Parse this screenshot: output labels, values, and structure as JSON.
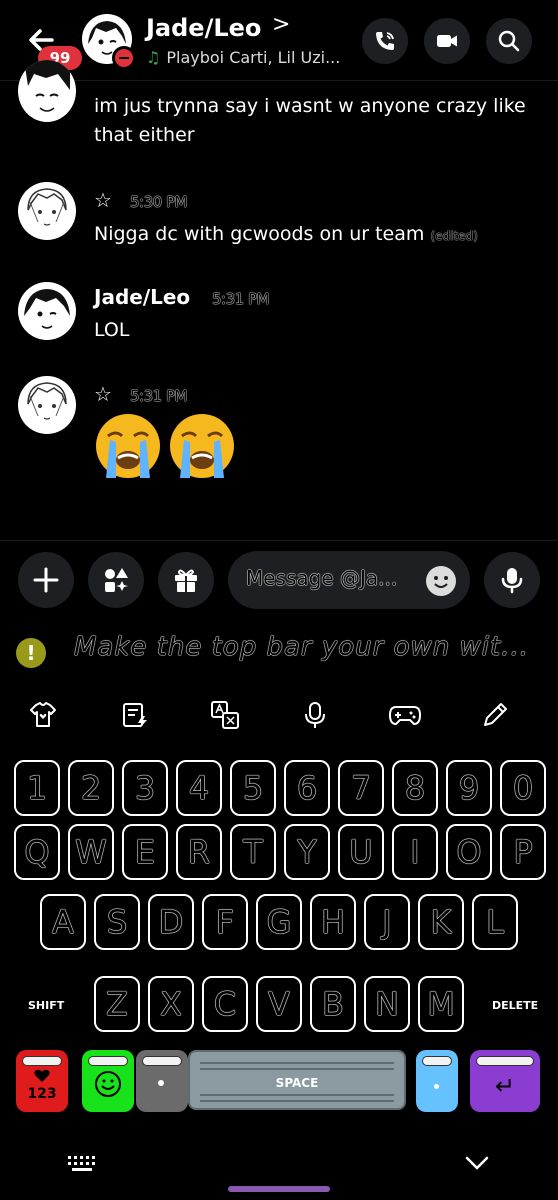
{
  "header": {
    "unread_badge": "99",
    "title": "Jade/Leo",
    "title_chevron": ">",
    "activity_icon": "♫",
    "activity": "Playboi Carti, Lil Uzi..."
  },
  "messages": [
    {
      "text": "im jus trynna say i wasnt w anyone crazy like that either"
    },
    {
      "author": "☆",
      "time": "5:30 PM",
      "text": "Nigga dc with gcwoods on ur team",
      "edited": "(edited)"
    },
    {
      "author": "Jade/Leo",
      "time": "5:31 PM",
      "text": "LOL"
    },
    {
      "author": "☆",
      "time": "5:31 PM",
      "emoji": [
        "loudly-crying-face",
        "loudly-crying-face"
      ]
    }
  ],
  "composer": {
    "placeholder": "Message @Ja..."
  },
  "keyboard": {
    "hint": "Make the top bar your own wit...",
    "row_numbers": [
      "1",
      "2",
      "3",
      "4",
      "5",
      "6",
      "7",
      "8",
      "9",
      "0"
    ],
    "row_q": [
      "Q",
      "W",
      "E",
      "R",
      "T",
      "Y",
      "U",
      "I",
      "O",
      "P"
    ],
    "row_a": [
      "A",
      "S",
      "D",
      "F",
      "G",
      "H",
      "J",
      "K",
      "L"
    ],
    "row_z": [
      "Z",
      "X",
      "C",
      "V",
      "B",
      "N",
      "M"
    ],
    "shift_label": "SHIFT",
    "delete_label": "DELETE",
    "symbols_label": "123",
    "space_label": "SPACE",
    "enter_symbol": "↵",
    "colors": {
      "red": "#e01b1b",
      "green": "#17e21a",
      "gray": "#6b6b6b",
      "blue": "#66c2ff",
      "purple": "#8b3dd1"
    }
  }
}
